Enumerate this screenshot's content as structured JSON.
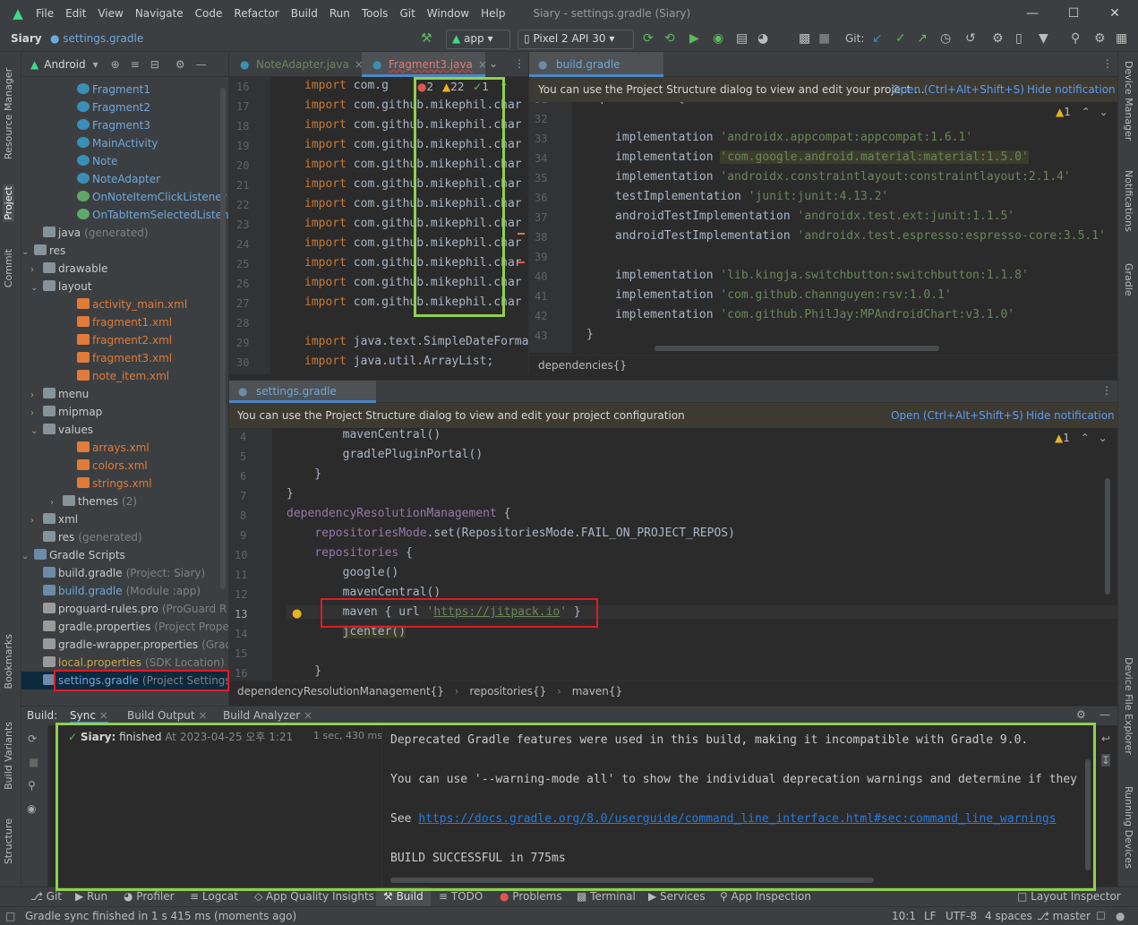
{
  "window": {
    "menu": [
      "File",
      "Edit",
      "View",
      "Navigate",
      "Code",
      "Refactor",
      "Build",
      "Run",
      "Tools",
      "Git",
      "Window",
      "Help"
    ],
    "title": "Siary - settings.gradle (Siary)"
  },
  "toolbar": {
    "project": "Siary",
    "file": "settings.gradle",
    "run_config": "app",
    "device": "Pixel 2 API 30",
    "git_label": "Git:"
  },
  "left_strip": [
    "Resource Manager",
    "Project",
    "Commit",
    "Bookmarks",
    "Build Variants",
    "Structure"
  ],
  "right_strip": [
    "Device Manager",
    "Notifications",
    "Gradle",
    "Device File Explorer",
    "Running Devices"
  ],
  "project_panel": {
    "view": "Android",
    "rows": [
      {
        "label": "Fragment1",
        "icon": "class",
        "ind": 78
      },
      {
        "label": "Fragment2",
        "icon": "class",
        "ind": 78
      },
      {
        "label": "Fragment3",
        "icon": "class",
        "ind": 78
      },
      {
        "label": "MainActivity",
        "icon": "class",
        "ind": 78
      },
      {
        "label": "Note",
        "icon": "class",
        "ind": 78
      },
      {
        "label": "NoteAdapter",
        "icon": "class",
        "ind": 78
      },
      {
        "label": "OnNoteItemClickListener",
        "icon": "iface",
        "ind": 78
      },
      {
        "label": "OnTabItemSelectedListener",
        "icon": "iface",
        "ind": 78
      },
      {
        "label": "java",
        "extra": "(generated)",
        "icon": "folder",
        "ind": 40
      },
      {
        "label": "res",
        "icon": "folder",
        "ind": 26,
        "arrow": "down"
      },
      {
        "label": "drawable",
        "icon": "folder",
        "ind": 40,
        "arrow": "right"
      },
      {
        "label": "layout",
        "icon": "folder",
        "ind": 40,
        "arrow": "down"
      },
      {
        "label": "activity_main.xml",
        "icon": "xml",
        "ind": 78
      },
      {
        "label": "fragment1.xml",
        "icon": "xml",
        "ind": 78
      },
      {
        "label": "fragment2.xml",
        "icon": "xml",
        "ind": 78
      },
      {
        "label": "fragment3.xml",
        "icon": "xml",
        "ind": 78
      },
      {
        "label": "note_item.xml",
        "icon": "xml",
        "ind": 78
      },
      {
        "label": "menu",
        "icon": "folder",
        "ind": 40,
        "arrow": "right"
      },
      {
        "label": "mipmap",
        "icon": "folder",
        "ind": 40,
        "arrow": "right"
      },
      {
        "label": "values",
        "icon": "folder",
        "ind": 40,
        "arrow": "down"
      },
      {
        "label": "arrays.xml",
        "icon": "xml",
        "ind": 78
      },
      {
        "label": "colors.xml",
        "icon": "xml",
        "ind": 78
      },
      {
        "label": "strings.xml",
        "icon": "xml",
        "ind": 78
      },
      {
        "label": "themes",
        "extra": "(2)",
        "icon": "folder",
        "ind": 62,
        "arrow": "right"
      },
      {
        "label": "xml",
        "icon": "folder",
        "ind": 40,
        "arrow": "right"
      },
      {
        "label": "res",
        "extra": "(generated)",
        "icon": "folder",
        "ind": 40
      },
      {
        "label": "Gradle Scripts",
        "icon": "gradle",
        "ind": 12,
        "arrow": "down"
      },
      {
        "label": "build.gradle",
        "extra": "(Project: Siary)",
        "icon": "gradle",
        "ind": 40
      },
      {
        "label": "build.gradle",
        "extra": "(Module :app)",
        "icon": "gradle",
        "ind": 40
      },
      {
        "label": "proguard-rules.pro",
        "extra": "(ProGuard R",
        "icon": "props",
        "ind": 40
      },
      {
        "label": "gradle.properties",
        "extra": "(Project Prope",
        "icon": "props",
        "ind": 40
      },
      {
        "label": "gradle-wrapper.properties",
        "extra": "(Grad",
        "icon": "props",
        "ind": 40
      },
      {
        "label": "local.properties",
        "extra": "(SDK Location)",
        "icon": "props",
        "ind": 40
      },
      {
        "label": "settings.gradle",
        "extra": "(Project Settings",
        "icon": "gradle",
        "ind": 40,
        "selected": true
      }
    ]
  },
  "editor1": {
    "tabs": [
      "NoteAdapter.java",
      "Fragment3.java"
    ],
    "inspection": {
      "errors": "2",
      "warnings": "22",
      "ok": "1"
    },
    "lines": [
      {
        "n": "16",
        "code": "import com.g"
      },
      {
        "n": "17",
        "code": "import com.github.mikephil.char"
      },
      {
        "n": "18",
        "code": "import com.github.mikephil.char"
      },
      {
        "n": "19",
        "code": "import com.github.mikephil.char"
      },
      {
        "n": "20",
        "code": "import com.github.mikephil.char"
      },
      {
        "n": "21",
        "code": "import com.github.mikephil.char"
      },
      {
        "n": "22",
        "code": "import com.github.mikephil.char"
      },
      {
        "n": "23",
        "code": "import com.github.mikephil.char"
      },
      {
        "n": "24",
        "code": "import com.github.mikephil.char"
      },
      {
        "n": "25",
        "code": "import com.github.mikephil.char"
      },
      {
        "n": "26",
        "code": "import com.github.mikephil.char"
      },
      {
        "n": "27",
        "code": "import com.github.mikephil.char"
      },
      {
        "n": "28",
        "code": ""
      },
      {
        "n": "29",
        "code": "import java.text.SimpleDateForma"
      },
      {
        "n": "30",
        "code": "import java.util.ArrayList;"
      }
    ]
  },
  "editor2": {
    "tab": "build.gradle (:app)",
    "notice": "You can use the Project Structure dialog to view and edit your project ...",
    "open_link": "Open (Ctrl+Alt+Shift+S)",
    "hide_link": "Hide notification",
    "warn_count": "1",
    "lines": [
      {
        "n": "31",
        "kw": "",
        "str": "",
        "plain": "dependencies {"
      },
      {
        "n": "32",
        "kw": "",
        "str": "",
        "plain": ""
      },
      {
        "n": "33",
        "kw": "implementation",
        "str": "'androidx.appcompat:appcompat:1.6.1'"
      },
      {
        "n": "34",
        "kw": "implementation",
        "str": "'com.google.android.material:material:1.5.0'",
        "hl": true
      },
      {
        "n": "35",
        "kw": "implementation",
        "str": "'androidx.constraintlayout:constraintlayout:2.1.4'"
      },
      {
        "n": "36",
        "kw": "testImplementation",
        "str": "'junit:junit:4.13.2'"
      },
      {
        "n": "37",
        "kw": "androidTestImplementation",
        "str": "'androidx.test.ext:junit:1.1.5'"
      },
      {
        "n": "38",
        "kw": "androidTestImplementation",
        "str": "'androidx.test.espresso:espresso-core:3.5.1'"
      },
      {
        "n": "39",
        "kw": "",
        "str": "",
        "plain": ""
      },
      {
        "n": "40",
        "kw": "implementation",
        "str": "'lib.kingja.switchbutton:switchbutton:1.1.8'"
      },
      {
        "n": "41",
        "kw": "implementation",
        "str": "'com.github.channguyen:rsv:1.0.1'"
      },
      {
        "n": "42",
        "kw": "implementation",
        "str": "'com.github.PhilJay:MPAndroidChart:v3.1.0'"
      },
      {
        "n": "43",
        "kw": "",
        "str": "",
        "plain": "}"
      }
    ],
    "breadcrumb": "dependencies{}"
  },
  "editor3": {
    "tab": "settings.gradle (Siary)",
    "notice": "You can use the Project Structure dialog to view and edit your project configuration",
    "open_link": "Open (Ctrl+Alt+Shift+S)",
    "hide_link": "Hide notification",
    "warn_count": "1",
    "lines": [
      {
        "n": "4",
        "code": "        mavenCentral()"
      },
      {
        "n": "5",
        "code": "        gradlePluginPortal()"
      },
      {
        "n": "6",
        "code": "    }"
      },
      {
        "n": "7",
        "code": "}"
      },
      {
        "n": "8",
        "code": "dependencyResolutionManagement {"
      },
      {
        "n": "9",
        "code": "    repositoriesMode.set(RepositoriesMode.FAIL_ON_PROJECT_REPOS)"
      },
      {
        "n": "10",
        "code": "    repositories {"
      },
      {
        "n": "11",
        "code": "        google()"
      },
      {
        "n": "12",
        "code": "        mavenCentral()"
      },
      {
        "n": "13",
        "code": "        maven { url 'https://jitpack.io' }"
      },
      {
        "n": "14",
        "code": "        jcenter()"
      },
      {
        "n": "15",
        "code": ""
      },
      {
        "n": "16",
        "code": "    }"
      }
    ],
    "breadcrumbs": [
      "dependencyResolutionManagement{}",
      "repositories{}",
      "maven{}"
    ]
  },
  "build": {
    "label": "Build:",
    "tabs": [
      "Sync",
      "Build Output",
      "Build Analyzer"
    ],
    "status_name": "Siary:",
    "status_text": "finished",
    "status_time": "At 2023-04-25 오후 1:21",
    "duration": "1 sec, 430 ms",
    "output": [
      "Deprecated Gradle features were used in this build, making it incompatible with Gradle 9.0.",
      "",
      "You can use '--warning-mode all' to show the individual deprecation warnings and determine if they",
      "",
      "See ",
      "",
      "BUILD SUCCESSFUL in 775ms"
    ],
    "link": "https://docs.gradle.org/8.0/userguide/command_line_interface.html#sec:command_line_warnings"
  },
  "bottom_tools": [
    "Git",
    "Run",
    "Profiler",
    "Logcat",
    "App Quality Insights",
    "Build",
    "TODO",
    "Problems",
    "Terminal",
    "Services",
    "App Inspection"
  ],
  "layout_inspector": "Layout Inspector",
  "status_bar": {
    "message": "Gradle sync finished in 1 s 415 ms (moments ago)",
    "position": "10:1",
    "line_sep": "LF",
    "encoding": "UTF-8",
    "indent": "4 spaces",
    "branch": "master"
  },
  "colors": {
    "accent": "#3592c4",
    "highlight_red": "#e01b24",
    "highlight_green": "#8fd14f"
  }
}
